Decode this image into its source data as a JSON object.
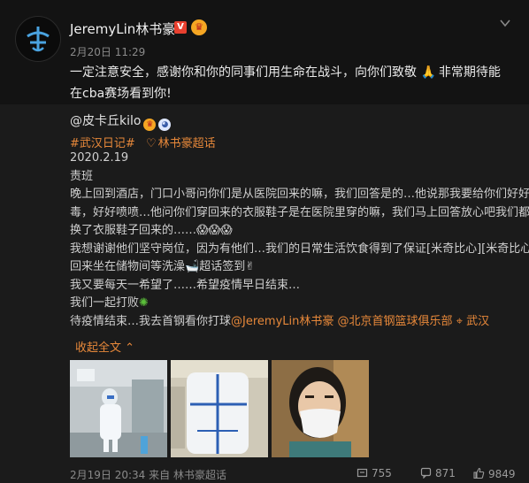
{
  "post": {
    "author": "JeremyLin林书豪",
    "verified_badge": "V",
    "time": "2月20日 11:29",
    "text_line1": "一定注意安全，感谢你和你的同事们用生命在战斗，向你们致敬",
    "text_line1_tail": "非常期待能",
    "text_line2": "在cba赛场看到你!"
  },
  "repost": {
    "user": "@皮卡丘kilo",
    "topic1": "#武汉日记#",
    "topic2": "林书豪超话",
    "date": "2020.2.19",
    "lines": [
      "责班",
      "晚上回到酒店，门口小哥问你们是从医院回来的嘛，我们回答是的…他说那我要给你们好好消",
      "毒，好好喷喷…他问你们穿回来的衣服鞋子是在医院里穿的嘛，我们马上回答放心吧我们都是",
      "换了衣服鞋子回来的……",
      "我想谢谢他们坚守岗位，因为有他们…我们的日常生活饮食得到了保证[米奇比心][米奇比心]",
      "回来坐在储物间等洗澡",
      "我又要每天一希望了……希望疫情早日结束…",
      "我们一起打败",
      "待疫情结束…我去首钢看你打球"
    ],
    "line6_tail": "超话签到",
    "mention1": "@JeremyLin林书豪",
    "mention2": "@北京首钢篮球俱乐部",
    "location": "武汉",
    "collapse": "收起全文",
    "meta_time": "2月19日 20:34",
    "meta_source": "来自 林书豪超话",
    "reposts": "755",
    "comments": "871",
    "likes": "9849"
  },
  "icons": [
    "weibo-logo-icon",
    "chevron-down-icon",
    "supertopic-icon",
    "location-pin-icon",
    "repost-icon",
    "comment-icon",
    "like-icon"
  ],
  "colors": {
    "accent": "#e7883a",
    "background": "#111111",
    "repost_background": "#1b1b1b",
    "verified": "#e8402f"
  }
}
